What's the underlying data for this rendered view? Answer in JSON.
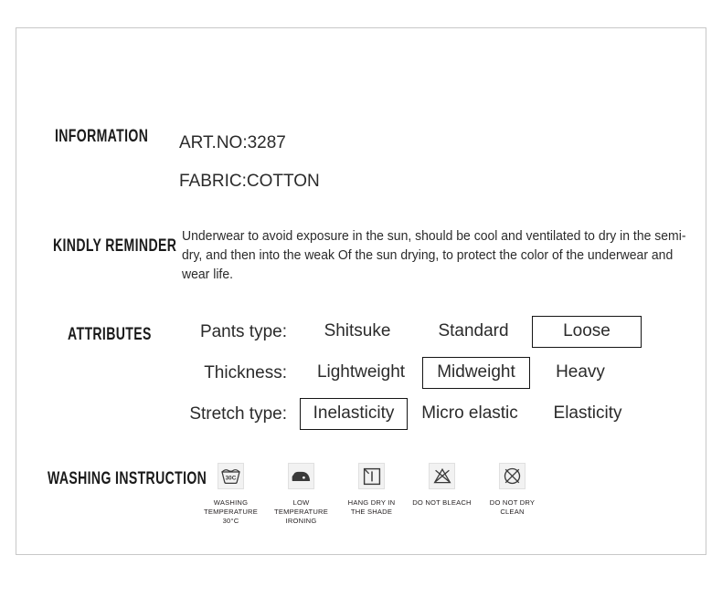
{
  "card": {
    "border_color": "#c8c8c8",
    "background": "#ffffff"
  },
  "sections": {
    "information": {
      "heading": "INFORMATION",
      "art_no": "ART.NO:3287",
      "fabric": "FABRIC:COTTON"
    },
    "kindly_reminder": {
      "heading": "KINDLY REMINDER",
      "text": "Underwear to avoid exposure in the sun, should be cool and ventilated to dry in the semi-dry, and then into the weak Of the sun drying, to protect the color of the underwear and wear life."
    },
    "attributes": {
      "heading": "ATTRIBUTES",
      "rows": [
        {
          "label": "Pants type:",
          "options": [
            {
              "text": "Shitsuke",
              "selected": false
            },
            {
              "text": "Standard",
              "selected": false
            },
            {
              "text": "Loose",
              "selected": true
            }
          ]
        },
        {
          "label": "Thickness:",
          "options": [
            {
              "text": "Lightweight",
              "selected": false
            },
            {
              "text": "Midweight",
              "selected": true
            },
            {
              "text": "Heavy",
              "selected": false
            }
          ]
        },
        {
          "label": "Stretch type:",
          "options": [
            {
              "text": "Inelasticity",
              "selected": true
            },
            {
              "text": "Micro elastic",
              "selected": false
            },
            {
              "text": "Elasticity",
              "selected": false
            }
          ]
        }
      ]
    },
    "washing_instruction": {
      "heading": "WASHING INSTRUCTION",
      "symbols": [
        {
          "icon": "wash-tub-30c-icon",
          "caption": "WASHING\nTEMPERATURE 30°C",
          "temperature": "30°C"
        },
        {
          "icon": "iron-low-temperature-icon",
          "caption": "LOW TEMPERATURE\nIRONING"
        },
        {
          "icon": "hang-dry-in-shade-icon",
          "caption": "HANG DRY IN\nTHE SHADE"
        },
        {
          "icon": "do-not-bleach-icon",
          "caption": "DO NOT BLEACH"
        },
        {
          "icon": "do-not-dry-clean-icon",
          "caption": "DO NOT DRY\nCLEAN"
        }
      ]
    }
  }
}
